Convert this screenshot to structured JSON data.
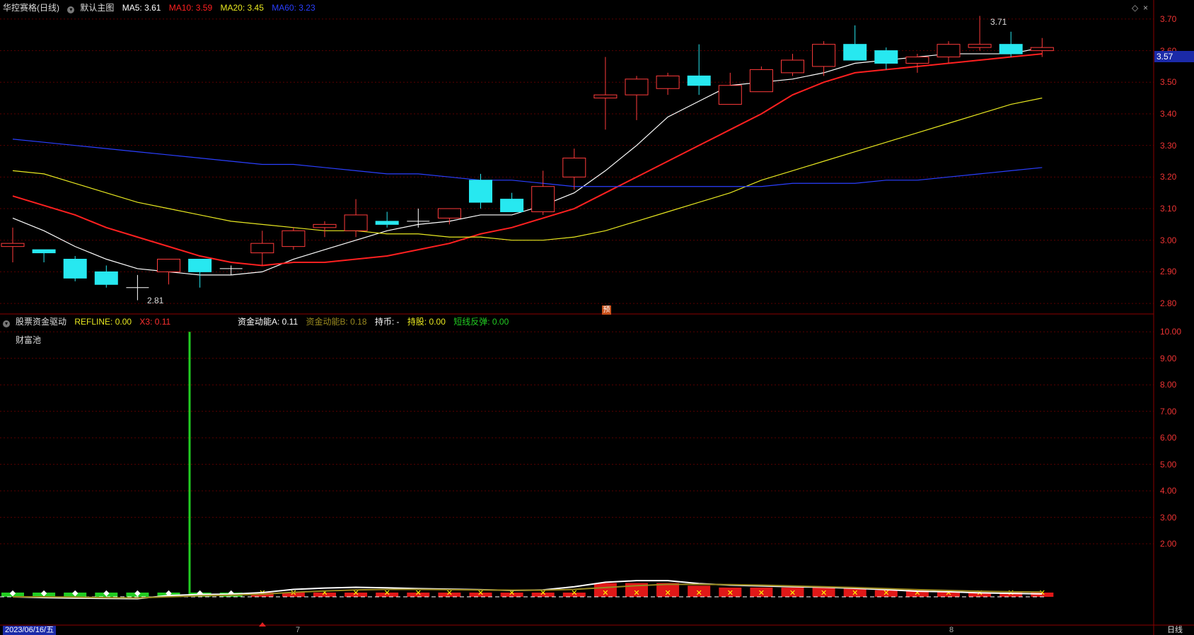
{
  "header": {
    "stock_name": "华控赛格(日线)",
    "main_chart_label": "默认主图",
    "ma5": {
      "label": "MA5:",
      "value": "3.61",
      "color": "#ffffff"
    },
    "ma10": {
      "label": "MA10:",
      "value": "3.59",
      "color": "#ff2020"
    },
    "ma20": {
      "label": "MA20:",
      "value": "3.45",
      "color": "#e8e820"
    },
    "ma60": {
      "label": "MA60:",
      "value": "3.23",
      "color": "#2a3fff"
    }
  },
  "indicator_header": {
    "name": "股票资金驱动",
    "refline": "REFLINE: 0.00",
    "x3": "X3: 0.11",
    "fund_a": "资金动能A: 0.11",
    "fund_b": "资金动能B: 0.18",
    "hold_coin": "持币: -",
    "hold_stock": "持股: 0.00",
    "rebound": "短线反弹: 0.00",
    "pool_label": "财富池"
  },
  "right_panel": {
    "current_price": "3.57",
    "price_ticks": [
      "3.70",
      "3.60",
      "3.50",
      "3.40",
      "3.30",
      "3.20",
      "3.10",
      "3.00",
      "2.90",
      "2.80"
    ],
    "indicator_ticks": [
      "10.00",
      "9.00",
      "8.00",
      "7.00",
      "6.00",
      "5.00",
      "4.00",
      "3.00",
      "2.00"
    ]
  },
  "bottom_bar": {
    "date": "2023/06/16/五",
    "month_7": "7",
    "month_8": "8",
    "period": "日线"
  },
  "annotations": {
    "high_label": "3.71",
    "low_label": "2.81",
    "forecast_marker": "预"
  },
  "chart_data": [
    {
      "type": "candlestick",
      "y_axis": {
        "range": [
          2.78,
          3.72
        ],
        "ticks": [
          2.8,
          2.9,
          3.0,
          3.1,
          3.2,
          3.3,
          3.4,
          3.5,
          3.6,
          3.7
        ]
      },
      "candles": [
        {
          "o": 2.98,
          "h": 3.04,
          "l": 2.93,
          "c": 2.99
        },
        {
          "o": 2.97,
          "h": 2.97,
          "l": 2.93,
          "c": 2.96
        },
        {
          "o": 2.94,
          "h": 2.95,
          "l": 2.87,
          "c": 2.88
        },
        {
          "o": 2.9,
          "h": 2.92,
          "l": 2.85,
          "c": 2.86
        },
        {
          "o": 2.85,
          "h": 2.89,
          "l": 2.81,
          "c": 2.85
        },
        {
          "o": 2.9,
          "h": 2.94,
          "l": 2.86,
          "c": 2.94
        },
        {
          "o": 2.94,
          "h": 2.94,
          "l": 2.85,
          "c": 2.9
        },
        {
          "o": 2.91,
          "h": 2.92,
          "l": 2.89,
          "c": 2.91
        },
        {
          "o": 2.96,
          "h": 3.03,
          "l": 2.92,
          "c": 2.99
        },
        {
          "o": 2.98,
          "h": 3.04,
          "l": 2.97,
          "c": 3.03
        },
        {
          "o": 3.04,
          "h": 3.06,
          "l": 3.01,
          "c": 3.05
        },
        {
          "o": 3.03,
          "h": 3.13,
          "l": 3.01,
          "c": 3.08
        },
        {
          "o": 3.06,
          "h": 3.09,
          "l": 3.04,
          "c": 3.05
        },
        {
          "o": 3.06,
          "h": 3.1,
          "l": 3.04,
          "c": 3.06
        },
        {
          "o": 3.07,
          "h": 3.1,
          "l": 3.05,
          "c": 3.1
        },
        {
          "o": 3.19,
          "h": 3.21,
          "l": 3.1,
          "c": 3.12
        },
        {
          "o": 3.13,
          "h": 3.15,
          "l": 3.09,
          "c": 3.09
        },
        {
          "o": 3.09,
          "h": 3.22,
          "l": 3.08,
          "c": 3.17
        },
        {
          "o": 3.2,
          "h": 3.29,
          "l": 3.16,
          "c": 3.26
        },
        {
          "o": 3.45,
          "h": 3.58,
          "l": 3.35,
          "c": 3.46
        },
        {
          "o": 3.46,
          "h": 3.52,
          "l": 3.38,
          "c": 3.51
        },
        {
          "o": 3.48,
          "h": 3.53,
          "l": 3.46,
          "c": 3.52
        },
        {
          "o": 3.52,
          "h": 3.62,
          "l": 3.46,
          "c": 3.49
        },
        {
          "o": 3.43,
          "h": 3.53,
          "l": 3.43,
          "c": 3.49
        },
        {
          "o": 3.47,
          "h": 3.55,
          "l": 3.47,
          "c": 3.54
        },
        {
          "o": 3.53,
          "h": 3.59,
          "l": 3.52,
          "c": 3.57
        },
        {
          "o": 3.55,
          "h": 3.63,
          "l": 3.52,
          "c": 3.62
        },
        {
          "o": 3.62,
          "h": 3.68,
          "l": 3.57,
          "c": 3.57
        },
        {
          "o": 3.6,
          "h": 3.61,
          "l": 3.54,
          "c": 3.56
        },
        {
          "o": 3.56,
          "h": 3.59,
          "l": 3.53,
          "c": 3.58
        },
        {
          "o": 3.58,
          "h": 3.63,
          "l": 3.56,
          "c": 3.62
        },
        {
          "o": 3.61,
          "h": 3.71,
          "l": 3.6,
          "c": 3.62
        },
        {
          "o": 3.62,
          "h": 3.66,
          "l": 3.58,
          "c": 3.59
        },
        {
          "o": 3.6,
          "h": 3.64,
          "l": 3.58,
          "c": 3.61
        }
      ],
      "series": [
        {
          "name": "MA5",
          "color": "#ffffff",
          "values": [
            3.07,
            3.03,
            2.98,
            2.94,
            2.91,
            2.9,
            2.89,
            2.89,
            2.9,
            2.94,
            2.97,
            3.0,
            3.03,
            3.05,
            3.06,
            3.08,
            3.08,
            3.11,
            3.15,
            3.22,
            3.3,
            3.39,
            3.44,
            3.49,
            3.5,
            3.51,
            3.53,
            3.56,
            3.57,
            3.58,
            3.59,
            3.59,
            3.59,
            3.61
          ]
        },
        {
          "name": "MA10",
          "color": "#ff2020",
          "values": [
            3.14,
            3.11,
            3.08,
            3.04,
            3.01,
            2.98,
            2.95,
            2.93,
            2.92,
            2.93,
            2.93,
            2.94,
            2.95,
            2.97,
            2.99,
            3.02,
            3.04,
            3.07,
            3.1,
            3.15,
            3.2,
            3.25,
            3.3,
            3.35,
            3.4,
            3.46,
            3.5,
            3.53,
            3.54,
            3.55,
            3.56,
            3.57,
            3.58,
            3.59
          ]
        },
        {
          "name": "MA20",
          "color": "#e8e820",
          "values": [
            3.22,
            3.21,
            3.18,
            3.15,
            3.12,
            3.1,
            3.08,
            3.06,
            3.05,
            3.04,
            3.03,
            3.03,
            3.02,
            3.02,
            3.01,
            3.01,
            3.0,
            3.0,
            3.01,
            3.03,
            3.06,
            3.09,
            3.12,
            3.15,
            3.19,
            3.22,
            3.25,
            3.28,
            3.31,
            3.34,
            3.37,
            3.4,
            3.43,
            3.45
          ]
        },
        {
          "name": "MA60",
          "color": "#2a3fff",
          "values": [
            3.32,
            3.31,
            3.3,
            3.29,
            3.28,
            3.27,
            3.26,
            3.25,
            3.24,
            3.24,
            3.23,
            3.22,
            3.21,
            3.21,
            3.2,
            3.19,
            3.19,
            3.18,
            3.17,
            3.17,
            3.17,
            3.17,
            3.17,
            3.17,
            3.17,
            3.18,
            3.18,
            3.18,
            3.19,
            3.19,
            3.2,
            3.21,
            3.22,
            3.23
          ]
        }
      ]
    },
    {
      "type": "bar",
      "y_axis": {
        "range": [
          0,
          10.3
        ],
        "ticks": [
          2,
          3,
          4,
          5,
          6,
          7,
          8,
          9,
          10
        ]
      },
      "bars": [
        0.16,
        0.16,
        0.16,
        0.16,
        0.16,
        0.16,
        0.16,
        0.16,
        0.16,
        0.16,
        0.16,
        0.16,
        0.16,
        0.16,
        0.16,
        0.16,
        0.16,
        0.16,
        0.16,
        0.52,
        0.52,
        0.52,
        0.42,
        0.35,
        0.35,
        0.35,
        0.35,
        0.35,
        0.25,
        0.25,
        0.2,
        0.16,
        0.16,
        0.16
      ],
      "bar_colors": [
        "green",
        "green",
        "green",
        "green",
        "green",
        "green",
        "green",
        "green",
        "red",
        "red",
        "red",
        "red",
        "red",
        "red",
        "red",
        "red",
        "red",
        "red",
        "red",
        "red",
        "red",
        "red",
        "red",
        "red",
        "red",
        "red",
        "red",
        "red",
        "red",
        "red",
        "red",
        "red",
        "red",
        "red"
      ],
      "spike": {
        "index": 5,
        "value": 10.0,
        "color": "#22cc22"
      },
      "series": [
        {
          "name": "资金动能A",
          "color": "#ffffff",
          "values": [
            0.0,
            -0.03,
            -0.05,
            -0.06,
            -0.07,
            0.05,
            0.09,
            0.1,
            0.16,
            0.28,
            0.33,
            0.36,
            0.34,
            0.31,
            0.29,
            0.27,
            0.24,
            0.26,
            0.38,
            0.55,
            0.61,
            0.61,
            0.5,
            0.44,
            0.41,
            0.38,
            0.36,
            0.32,
            0.27,
            0.21,
            0.19,
            0.15,
            0.13,
            0.11
          ]
        },
        {
          "name": "资金动能B",
          "color": "#9a8a20",
          "values": [
            0.0,
            0.0,
            -0.01,
            -0.03,
            -0.04,
            0.0,
            0.04,
            0.06,
            0.1,
            0.17,
            0.22,
            0.26,
            0.28,
            0.28,
            0.27,
            0.26,
            0.25,
            0.25,
            0.28,
            0.35,
            0.42,
            0.47,
            0.47,
            0.46,
            0.44,
            0.41,
            0.38,
            0.35,
            0.31,
            0.27,
            0.24,
            0.21,
            0.19,
            0.18
          ]
        }
      ]
    }
  ]
}
